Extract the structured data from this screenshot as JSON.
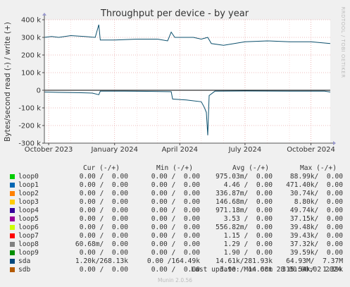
{
  "chart_data": {
    "type": "line",
    "title": "Throughput per device - by year",
    "ylabel": "Bytes/second read (-) / write (+)",
    "ylim": [
      -300000,
      400000
    ],
    "yticks": [
      {
        "value": 400000,
        "label": "400 k"
      },
      {
        "value": 300000,
        "label": "300 k"
      },
      {
        "value": 200000,
        "label": "200 k"
      },
      {
        "value": 100000,
        "label": "100 k"
      },
      {
        "value": 0,
        "label": "0"
      },
      {
        "value": -100000,
        "label": "-100 k"
      },
      {
        "value": -200000,
        "label": "-200 k"
      },
      {
        "value": -300000,
        "label": "-300 k"
      }
    ],
    "xrange": [
      "2023-09-25",
      "2024-10-28"
    ],
    "xticks": [
      {
        "date": "2023-10-01",
        "label": "October 2023"
      },
      {
        "date": "2024-01-01",
        "label": "January 2024"
      },
      {
        "date": "2024-04-01",
        "label": "April 2024"
      },
      {
        "date": "2024-07-01",
        "label": "July 2024"
      },
      {
        "date": "2024-10-01",
        "label": "October 2024"
      }
    ],
    "series": [
      {
        "name": "sda",
        "color": "#0b4f6c",
        "write": [
          [
            "2023-09-25",
            300000
          ],
          [
            "2023-10-05",
            305000
          ],
          [
            "2023-10-15",
            300000
          ],
          [
            "2023-11-01",
            310000
          ],
          [
            "2023-11-20",
            305000
          ],
          [
            "2023-12-05",
            300000
          ],
          [
            "2023-12-10",
            372000
          ],
          [
            "2023-12-12",
            285000
          ],
          [
            "2024-01-01",
            285000
          ],
          [
            "2024-02-01",
            290000
          ],
          [
            "2024-03-01",
            290000
          ],
          [
            "2024-03-15",
            280000
          ],
          [
            "2024-03-20",
            330000
          ],
          [
            "2024-03-25",
            300000
          ],
          [
            "2024-04-20",
            300000
          ],
          [
            "2024-05-01",
            290000
          ],
          [
            "2024-05-10",
            300000
          ],
          [
            "2024-05-15",
            265000
          ],
          [
            "2024-06-01",
            255000
          ],
          [
            "2024-07-01",
            275000
          ],
          [
            "2024-08-01",
            280000
          ],
          [
            "2024-09-01",
            275000
          ],
          [
            "2024-10-01",
            275000
          ],
          [
            "2024-10-28",
            265000
          ]
        ],
        "read": [
          [
            "2023-09-25",
            -10000
          ],
          [
            "2023-10-15",
            -12000
          ],
          [
            "2023-11-15",
            -14000
          ],
          [
            "2023-12-01",
            -16000
          ],
          [
            "2023-12-10",
            -25000
          ],
          [
            "2023-12-12",
            -5000
          ],
          [
            "2024-01-15",
            -5000
          ],
          [
            "2024-02-15",
            -6000
          ],
          [
            "2024-03-20",
            -8000
          ],
          [
            "2024-03-22",
            -50000
          ],
          [
            "2024-04-10",
            -55000
          ],
          [
            "2024-05-01",
            -65000
          ],
          [
            "2024-05-05",
            -95000
          ],
          [
            "2024-05-08",
            -125000
          ],
          [
            "2024-05-10",
            -255000
          ],
          [
            "2024-05-12",
            -30000
          ],
          [
            "2024-05-20",
            -5000
          ],
          [
            "2024-07-01",
            -4000
          ],
          [
            "2024-09-01",
            -5000
          ],
          [
            "2024-10-20",
            -5000
          ],
          [
            "2024-10-28",
            -10000
          ]
        ]
      }
    ]
  },
  "side_label": "RRDTOOL / TOBI OETIKER",
  "legend": {
    "headers": {
      "cur": "Cur (-/+)",
      "min": "Min (-/+)",
      "avg": "Avg (-/+)",
      "max": "Max (-/+)"
    },
    "rows": [
      {
        "name": "loop0",
        "color": "#00cc00",
        "cur": "0.00 /  0.00",
        "min": "0.00 /  0.00",
        "avg": "975.03m/  0.00",
        "max": "88.99k/  0.00"
      },
      {
        "name": "loop1",
        "color": "#0066b3",
        "cur": "0.00 /  0.00",
        "min": "0.00 /  0.00",
        "avg": "4.46 /  0.00",
        "max": "471.40k/  0.00"
      },
      {
        "name": "loop2",
        "color": "#ff8000",
        "cur": "0.00 /  0.00",
        "min": "0.00 /  0.00",
        "avg": "336.87m/  0.00",
        "max": "30.74k/  0.00"
      },
      {
        "name": "loop3",
        "color": "#ffcc00",
        "cur": "0.00 /  0.00",
        "min": "0.00 /  0.00",
        "avg": "146.68m/  0.00",
        "max": "8.80k/  0.00"
      },
      {
        "name": "loop4",
        "color": "#330099",
        "cur": "0.00 /  0.00",
        "min": "0.00 /  0.00",
        "avg": "971.18m/  0.00",
        "max": "49.74k/  0.00"
      },
      {
        "name": "loop5",
        "color": "#990099",
        "cur": "0.00 /  0.00",
        "min": "0.00 /  0.00",
        "avg": "3.53 /  0.00",
        "max": "37.15k/  0.00"
      },
      {
        "name": "loop6",
        "color": "#ccff00",
        "cur": "0.00 /  0.00",
        "min": "0.00 /  0.00",
        "avg": "556.82m/  0.00",
        "max": "39.48k/  0.00"
      },
      {
        "name": "loop7",
        "color": "#ff0000",
        "cur": "0.00 /  0.00",
        "min": "0.00 /  0.00",
        "avg": "1.15 /  0.00",
        "max": "39.43k/  0.00"
      },
      {
        "name": "loop8",
        "color": "#808080",
        "cur": "60.68m/  0.00",
        "min": "0.00 /  0.00",
        "avg": "1.29 /  0.00",
        "max": "37.32k/  0.00"
      },
      {
        "name": "loop9",
        "color": "#008f00",
        "cur": "0.00 /  0.00",
        "min": "0.00 /  0.00",
        "avg": "1.90 /  0.00",
        "max": "39.59k/  0.00"
      },
      {
        "name": "sda",
        "color": "#00487d",
        "cur": "1.20k/268.13k",
        "min": "0.00 /164.49k",
        "avg": "14.61k/281.93k",
        "max": "64.93M/  7.37M"
      },
      {
        "name": "sdb",
        "color": "#b35a00",
        "cur": "0.00 /  0.00",
        "min": "0.00 /  0.00",
        "avg": "3.90 / 14.68m",
        "max": "315.54k/  1.39k"
      }
    ]
  },
  "last_update": "Last update: Mon Oct 28 00:00:02 2024",
  "munin_version": "Munin 2.0.56"
}
